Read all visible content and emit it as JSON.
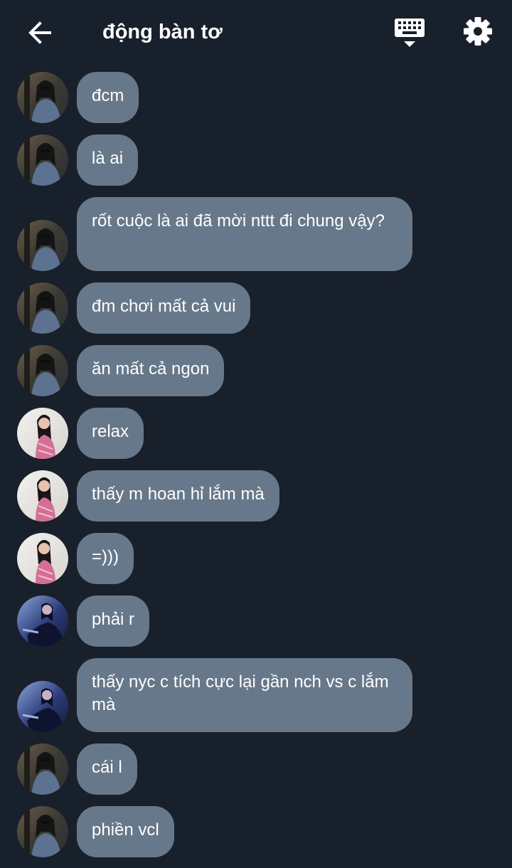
{
  "header": {
    "title": "động bàn tơ",
    "back_icon": "arrow-left-icon",
    "keyboard_icon": "keyboard-hide-icon",
    "settings_icon": "gear-icon"
  },
  "colors": {
    "background": "#18202b",
    "bubble": "#67788a",
    "text": "#ffffff"
  },
  "messages": [
    {
      "sender_avatar": "avatar-a",
      "text": "đcm"
    },
    {
      "sender_avatar": "avatar-a",
      "text": "là ai"
    },
    {
      "sender_avatar": "avatar-a",
      "text": "rốt cuộc là ai đã mời nttt đi chung vậy?"
    },
    {
      "sender_avatar": "avatar-a",
      "text": "đm chơi mất cả vui"
    },
    {
      "sender_avatar": "avatar-a",
      "text": "ăn mất cả ngon"
    },
    {
      "sender_avatar": "avatar-b",
      "text": "relax"
    },
    {
      "sender_avatar": "avatar-b",
      "text": "thấy m hoan hỉ lắm mà"
    },
    {
      "sender_avatar": "avatar-b",
      "text": "=)))"
    },
    {
      "sender_avatar": "avatar-c",
      "text": "phải r"
    },
    {
      "sender_avatar": "avatar-c",
      "text": "thấy nyc c tích cực lại gần nch vs c lắm mà"
    },
    {
      "sender_avatar": "avatar-a",
      "text": "cái l"
    },
    {
      "sender_avatar": "avatar-a",
      "text": "phiền vcl"
    }
  ]
}
